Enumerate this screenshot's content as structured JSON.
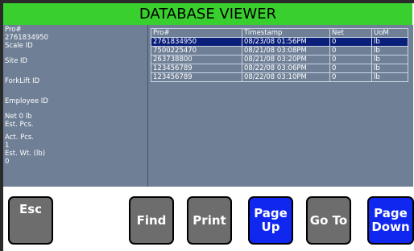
{
  "title": "DATABASE VIEWER",
  "details": {
    "pro_label": "Pro#",
    "pro_value": "2761834950",
    "scale_label": "Scale ID",
    "site_label": "Site ID",
    "forklift_label": "ForkLift ID",
    "employee_label": "Employee ID",
    "net_label": "Net 0 lb",
    "est_pcs_label": "Est. Pcs.",
    "act_pcs_label": "Act. Pcs.",
    "act_pcs_value": "1",
    "est_wt_label": "Est. Wt. (lb)",
    "est_wt_value": "0"
  },
  "table": {
    "columns": [
      "Pro#",
      "Timestamp",
      "Net",
      "UoM"
    ],
    "rows": [
      [
        "2761834950",
        "08/23/08 01:56PM",
        "0",
        "lb"
      ],
      [
        "7500225470",
        "08/21/08 03:08PM",
        "0",
        "lb"
      ],
      [
        "263738800",
        "08/21/08 03:20PM",
        "0",
        "lb"
      ],
      [
        "123456789",
        "08/22/08 03:06PM",
        "0",
        "lb"
      ],
      [
        "123456789",
        "08/22/08 03:10PM",
        "0",
        "lb"
      ]
    ],
    "selected_row": 0
  },
  "buttons": {
    "esc": "Esc",
    "find": "Find",
    "print": "Print",
    "page_up_1": "Page",
    "page_up_2": "Up",
    "go_to": "Go To",
    "page_down_1": "Page",
    "page_down_2": "Down"
  },
  "colors": {
    "title_bar": "#39d02f",
    "panel": "#6f7f96",
    "selected_row": "#0a1f7a",
    "gray_button": "#6d6d6d",
    "blue_button": "#1027f0"
  }
}
